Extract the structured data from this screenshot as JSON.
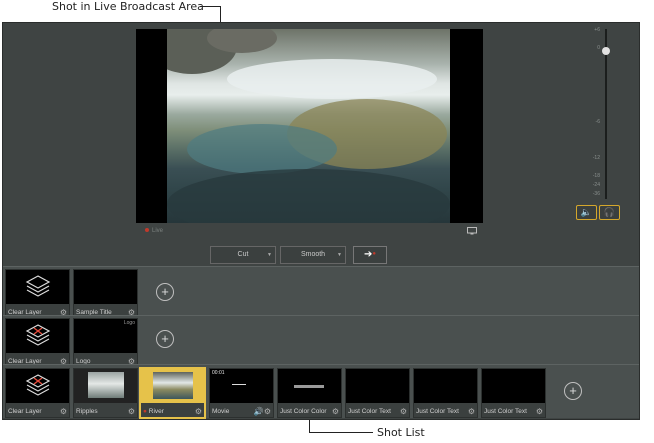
{
  "annotations": {
    "top": "Shot in Live Broadcast Area",
    "bottom": "Shot List"
  },
  "preview": {
    "live_label": "Live"
  },
  "audio": {
    "scale": [
      "+6",
      "0",
      "-6",
      "-12",
      "-18",
      "-24",
      "-36"
    ],
    "speaker_icon": "speaker-icon",
    "headphones_icon": "headphones-icon"
  },
  "transition": {
    "cut_label": "Cut",
    "smooth_label": "Smooth",
    "take_icon": "arrow-right-icon"
  },
  "layers": [
    {
      "tiles": [
        {
          "label": "Clear Layer"
        },
        {
          "label": "Sample Title"
        }
      ]
    },
    {
      "tiles": [
        {
          "label": "Clear Layer"
        },
        {
          "label": "Logo",
          "thumb_text": "Logo"
        }
      ]
    },
    {
      "tiles": [
        {
          "label": "Clear Layer"
        },
        {
          "label": "Ripples"
        },
        {
          "label": "River",
          "selected": true
        },
        {
          "label": "Movie",
          "thumb_text": "00:01"
        },
        {
          "label": "Just Color Color"
        },
        {
          "label": "Just Color Text"
        },
        {
          "label": "Just Color Text"
        },
        {
          "label": "Just Color Text"
        }
      ]
    }
  ],
  "colors": {
    "accent": "#e6c24a",
    "live_dot": "#c0392b",
    "app_bg": "#3f4443"
  }
}
